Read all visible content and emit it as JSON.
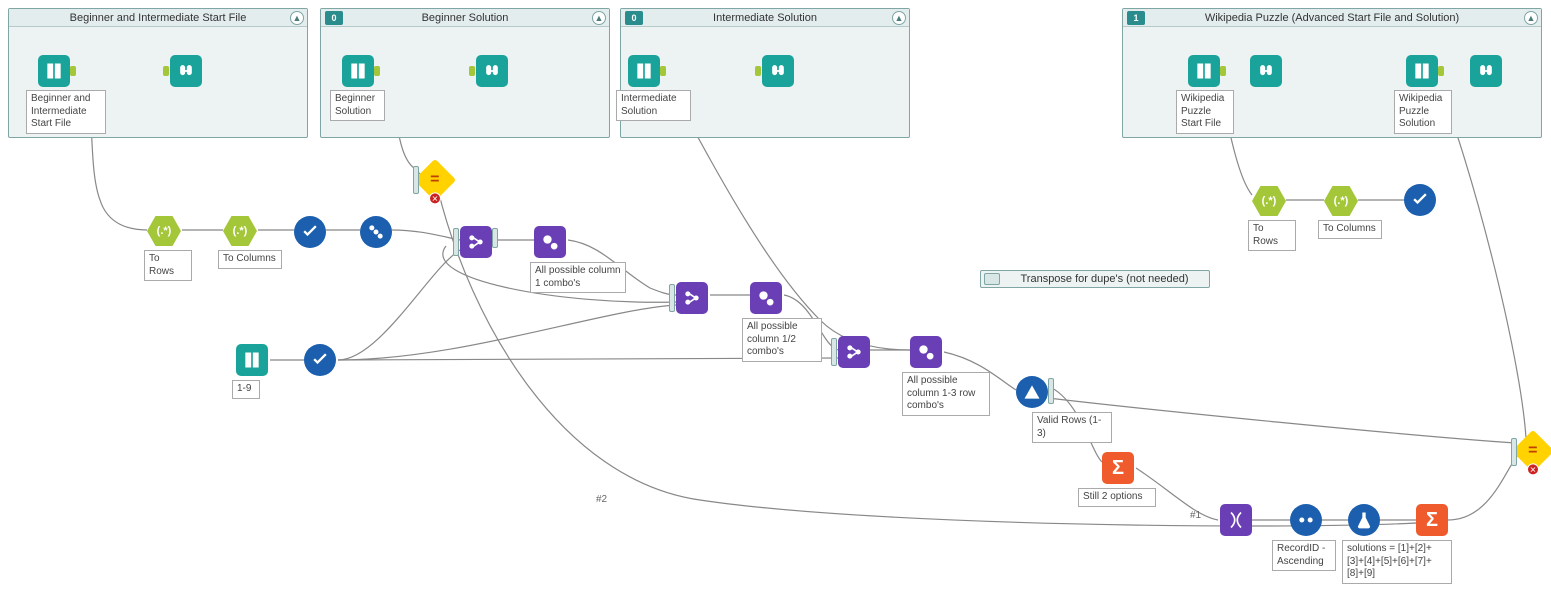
{
  "containers": {
    "c1": {
      "title": "Beginner and Intermediate Start File",
      "ord": ""
    },
    "c2": {
      "title": "Beginner Solution",
      "ord": "0"
    },
    "c3": {
      "title": "Intermediate Solution",
      "ord": "0"
    },
    "c4": {
      "title": "Wikipedia Puzzle (Advanced Start File and Solution)",
      "ord": "1"
    },
    "c5": {
      "title": "Transpose for dupe's (not needed)",
      "ord": ""
    }
  },
  "tool_annot": {
    "a_input1": "Beginner and Intermediate Start File",
    "a_input2": "Beginner Solution",
    "a_input3": "Intermediate Solution",
    "a_input4": "Wikipedia Puzzle Start File",
    "a_input5": "Wikipedia Puzzle Solution",
    "a_rows1": "To Rows",
    "a_cols1": "To Columns",
    "a_rows2": "To Rows",
    "a_cols2": "To Columns",
    "a_txt19": "1-9",
    "a_macro1": "All possible column 1 combo's",
    "a_macro2": "All possible column 1/2 combo's",
    "a_macro3": "All possible column 1-3 row combo's",
    "a_valid": "Valid Rows (1-3)",
    "a_still2": "Still 2 options",
    "a_sort": "RecordID - Ascending",
    "a_formula": "solutions = [1]+[2]+[3]+[4]+[5]+[6]+[7]+[8]+[9]"
  },
  "wire_labels": {
    "w1": "#1",
    "w2": "#2"
  }
}
